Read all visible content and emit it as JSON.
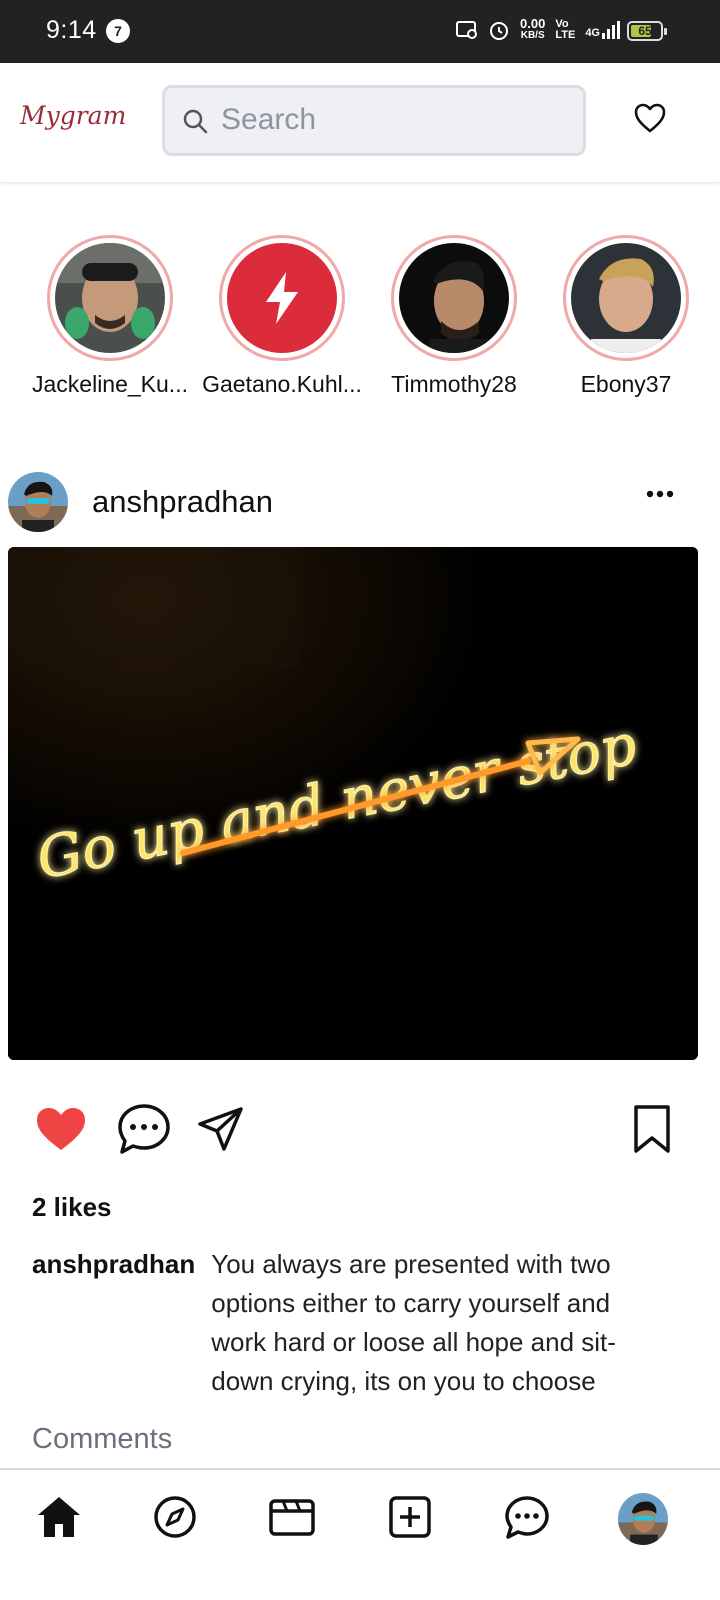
{
  "status_bar": {
    "time": "9:14",
    "notification_count": "7",
    "net_speed": "0.00",
    "net_speed_unit": "KB/S",
    "volte": "Vo\nLTE",
    "network": "4G",
    "battery": "65"
  },
  "header": {
    "logo": "Mygram",
    "search_placeholder": "Search"
  },
  "stories": [
    {
      "name": "Jackeline_Ku..."
    },
    {
      "name": "Gaetano.Kuhl..."
    },
    {
      "name": "Timmothy28"
    },
    {
      "name": "Ebony37"
    }
  ],
  "post": {
    "username": "anshpradhan",
    "likes": "2 likes",
    "caption_user": "anshpradhan",
    "caption_text": "You always are presented with two options either to carry yourself and work hard or loose all hope and sit-down crying, its on you to choose",
    "comments_label": "Comments",
    "image_text": "Go up and never stop",
    "liked": true
  },
  "colors": {
    "accent": "#ef4444",
    "story_ring": "#f0a8a8",
    "logo": "#9b2c3a",
    "status_bar": "#222222"
  }
}
